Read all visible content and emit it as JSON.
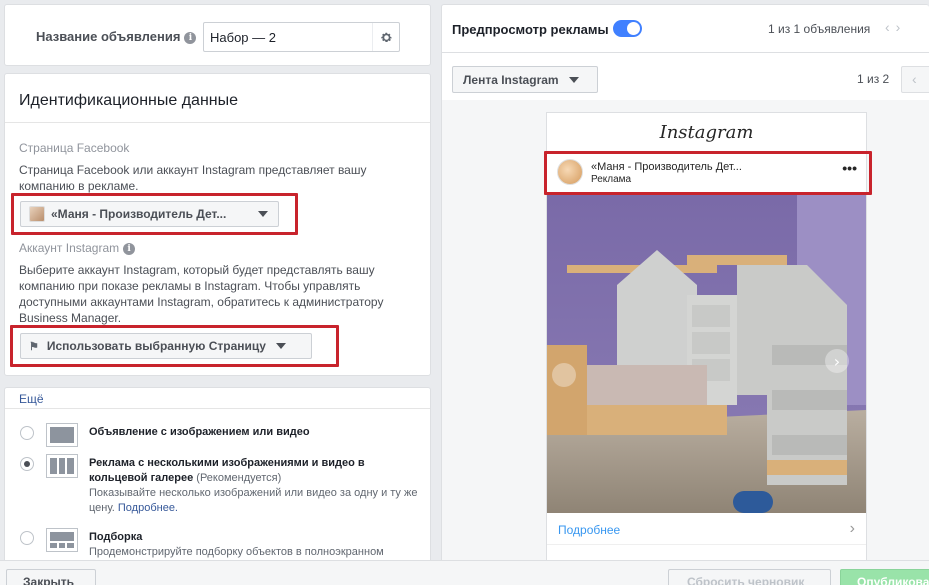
{
  "ad_name": {
    "label": "Название объявления",
    "value": "Набор — 2"
  },
  "identity": {
    "title": "Идентификационные данные",
    "facebook_page": {
      "label": "Страница Facebook",
      "description": "Страница Facebook или аккаунт Instagram представляет вашу компанию в рекламе.",
      "selected": "«Маня - Производитель Дет..."
    },
    "instagram": {
      "label": "Аккаунт Instagram",
      "description": "Выберите аккаунт Instagram, который будет представлять вашу компанию при показе рекламы в Instagram. Чтобы управлять доступными аккаунтами Instagram, обратитесь к администратору Business Manager.",
      "selected": "Использовать выбранную Страницу"
    }
  },
  "format": {
    "more_link": "Ещё",
    "options": [
      {
        "title": "Объявление с изображением или видео",
        "selected": false
      },
      {
        "title": "Реклама с несколькими изображениями и видео в кольцевой галерее",
        "recommended": "(Рекомендуется)",
        "description": "Показывайте несколько изображений или видео за одну и ту же цену.",
        "link": "Подробнее.",
        "selected": true
      },
      {
        "title": "Подборка",
        "description": "Продемонстрируйте подборку объектов в полноэкранном",
        "selected": false
      }
    ]
  },
  "preview": {
    "title": "Предпросмотр рекламы",
    "toggle_on": true,
    "ad_count": "1 из 1 объявления",
    "placement": "Лента Instagram",
    "placement_count": "1 из 2",
    "ig_logo": "Instagram",
    "account_name": "«Маня - Производитель Дет...",
    "account_sub": "Реклама",
    "cta": "Подробнее"
  },
  "footer": {
    "close": "Закрыть",
    "reset": "Сбросить черновик",
    "publish": "Опубликовать"
  },
  "colors": {
    "highlight": "#c8232c",
    "toggle": "#4080ff",
    "link": "#365899",
    "ig_link": "#3897f0"
  }
}
